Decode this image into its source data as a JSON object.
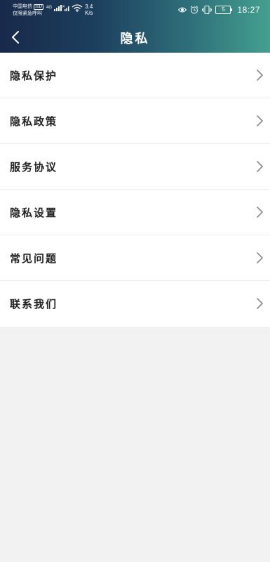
{
  "status_bar": {
    "carrier_line1": "中国电信",
    "carrier_hd": "HD",
    "carrier_line2": "仅限紧急呼叫",
    "network_type": "4G",
    "speed_value": "3.4",
    "speed_unit": "K/s",
    "battery": "5",
    "time": "18:27"
  },
  "header": {
    "title": "隐私"
  },
  "menu": {
    "items": [
      {
        "label": "隐私保护"
      },
      {
        "label": "隐私政策"
      },
      {
        "label": "服务协议"
      },
      {
        "label": "隐私设置"
      },
      {
        "label": "常见问题"
      },
      {
        "label": "联系我们"
      }
    ]
  }
}
